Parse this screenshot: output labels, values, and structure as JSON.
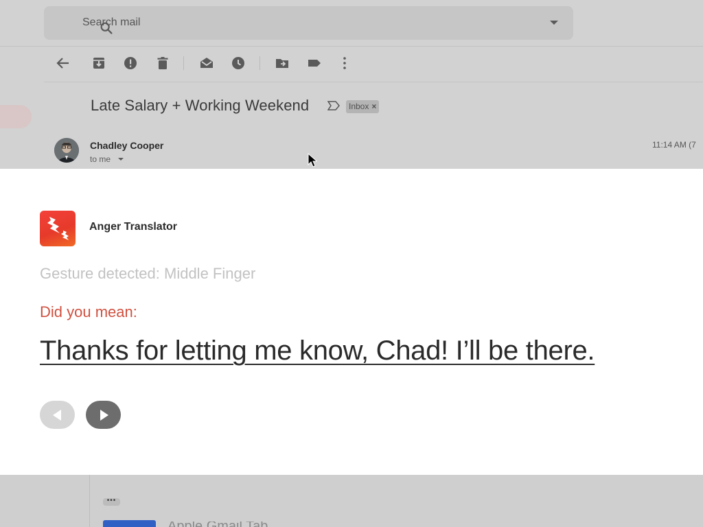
{
  "search": {
    "placeholder": "Search mail"
  },
  "toolbar": {
    "icons": [
      "back-arrow-icon",
      "archive-icon",
      "report-spam-icon",
      "delete-icon",
      "mark-unread-icon",
      "snooze-icon",
      "move-to-icon",
      "label-icon",
      "more-icon"
    ]
  },
  "email": {
    "subject": "Late Salary + Working Weekend",
    "badge": "Inbox",
    "badge_close": "×",
    "sender": "Chadley Cooper",
    "recipient": "to me",
    "time": "11:14 AM (7"
  },
  "translator": {
    "app_name": "Anger Translator",
    "gesture": "Gesture detected: Middle Finger",
    "prompt": "Did you mean:",
    "translation": "Thanks for letting me know, Chad! I’ll be there."
  },
  "bottom": {
    "ellipsis": "•••",
    "cut_text": "Apple Gmail Tab"
  },
  "colors": {
    "brand_red": "#e63a2b",
    "prompt_red": "#d0503f",
    "dim_background": "#d2d2d2",
    "overlay_background": "#ffffff"
  }
}
